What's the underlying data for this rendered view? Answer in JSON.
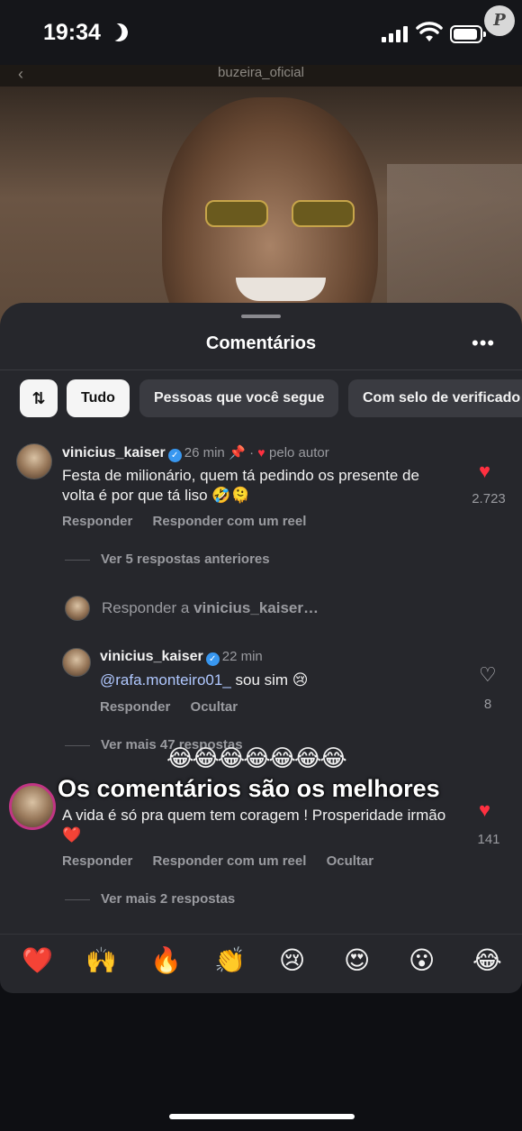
{
  "status": {
    "time": "19:34"
  },
  "watermark": "P",
  "post": {
    "username": "buzeira_oficial"
  },
  "sheet": {
    "title": "Comentários",
    "filters": {
      "sort_icon": "⇅",
      "items": [
        "Tudo",
        "Pessoas que você segue",
        "Com selo de verificado"
      ]
    }
  },
  "comments": [
    {
      "username": "vinicius_kaiser",
      "time": "26 min",
      "author_label": "pelo autor",
      "text": "Festa de milionário, quem tá pedindo os presente de volta é por que tá liso 🤣🫠",
      "likes": "2.723",
      "reply_label": "Responder",
      "reel_label": "Responder com um reel",
      "view_previous": "Ver 5 respostas anteriores"
    }
  ],
  "reply_prompt": {
    "prefix": "Responder a ",
    "target": "vinicius_kaiser…"
  },
  "reply": {
    "username": "vinicius_kaiser",
    "time": "22 min",
    "mention": "@rafa.monteiro01_",
    "text": " sou sim 😢",
    "likes": "8",
    "reply_label": "Responder",
    "hide_label": "Ocultar",
    "view_more": "Ver mais 47 respostas"
  },
  "comment2": {
    "text": "A vida é só pra quem tem coragem ! Prosperidade irmão ❤️",
    "likes": "141",
    "reply_label": "Responder",
    "reel_label": "Responder com um reel",
    "hide_label": "Ocultar",
    "view_more": "Ver mais 2 respostas"
  },
  "overlay": {
    "emojis": "😂😂😂😂😂😂😂",
    "caption": "Os comentários são os melhores"
  },
  "emoji_bar": [
    "❤️",
    "🙌",
    "🔥",
    "👏",
    "😢",
    "😍",
    "😮",
    "😂"
  ]
}
